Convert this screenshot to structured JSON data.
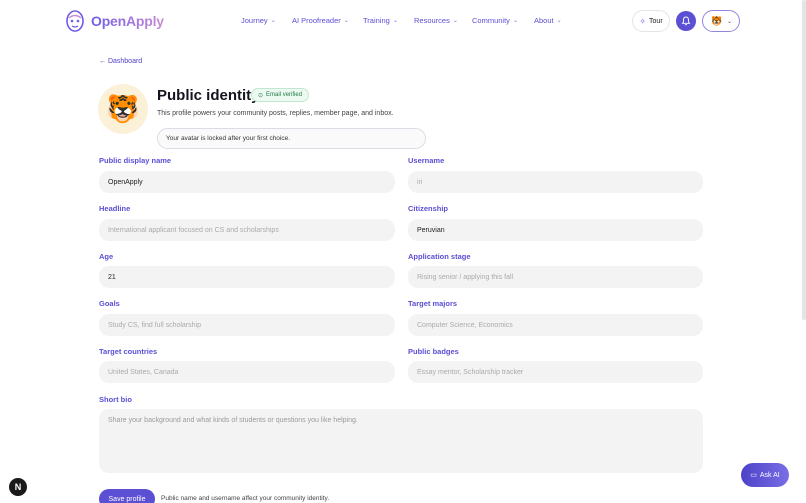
{
  "brand": {
    "name": "OpenApply"
  },
  "nav": [
    {
      "label": "Journey"
    },
    {
      "label": "AI Proofreader"
    },
    {
      "label": "Training"
    },
    {
      "label": "Resources"
    },
    {
      "label": "Community"
    },
    {
      "label": "About"
    }
  ],
  "header": {
    "tour_label": "Tour"
  },
  "breadcrumb": {
    "back_label": "← Dashboard"
  },
  "profile": {
    "title": "Public identity",
    "verified_badge": "Email verified",
    "description": "This profile powers your community posts, replies, member page, and inbox.",
    "avatar_note": "Your avatar is locked after your first choice.",
    "avatar_emoji": "🐯"
  },
  "fields": {
    "display_name": {
      "label": "Public display name",
      "value": "OpenApply",
      "placeholder": ""
    },
    "username": {
      "label": "Username",
      "value": "",
      "placeholder": "iri"
    },
    "headline": {
      "label": "Headline",
      "value": "",
      "placeholder": "International applicant focused on CS and scholarships"
    },
    "citizenship": {
      "label": "Citizenship",
      "value": "Peruvian",
      "placeholder": ""
    },
    "age": {
      "label": "Age",
      "value": "21",
      "placeholder": ""
    },
    "application_stage": {
      "label": "Application stage",
      "value": "",
      "placeholder": "Rising senior / applying this fall"
    },
    "goals": {
      "label": "Goals",
      "value": "",
      "placeholder": "Study CS, find full scholarship"
    },
    "target_majors": {
      "label": "Target majors",
      "value": "",
      "placeholder": "Computer Science, Economics"
    },
    "target_countries": {
      "label": "Target countries",
      "value": "",
      "placeholder": "United States, Canada"
    },
    "public_badges": {
      "label": "Public badges",
      "value": "",
      "placeholder": "Essay mentor, Scholarship tracker"
    },
    "short_bio": {
      "label": "Short bio",
      "value": "",
      "placeholder": "Share your background and what kinds of students or questions you like helping."
    }
  },
  "actions": {
    "save_label": "Save profile",
    "save_note": "Public name and username affect your community identity."
  },
  "floating": {
    "ask_ai_label": "Ask AI",
    "dev_badge": "N"
  },
  "colors": {
    "accent": "#5b4fd4",
    "label_secondary": "#d38a5e",
    "verified": "#1f7a45"
  }
}
